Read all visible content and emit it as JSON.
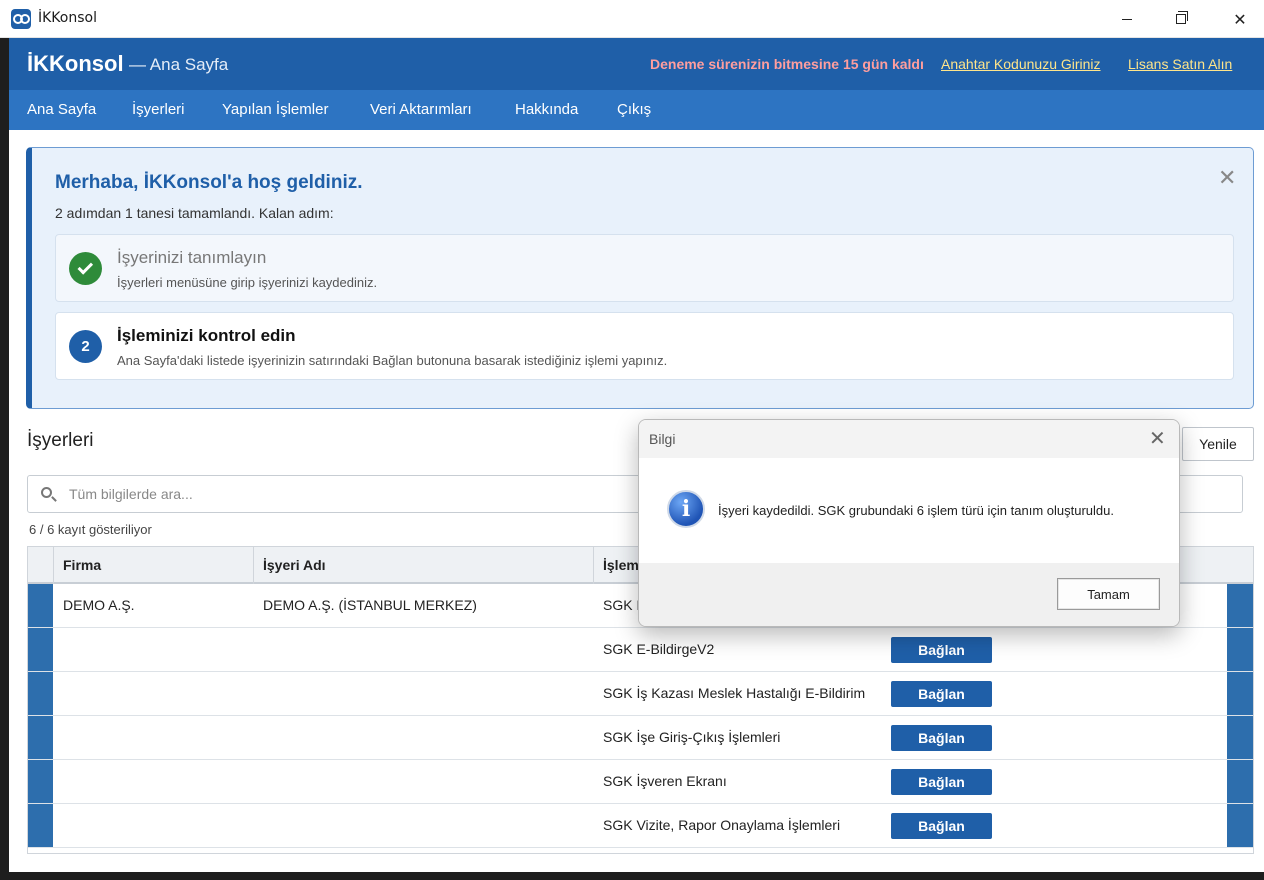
{
  "window": {
    "title": "İKKonsol"
  },
  "header": {
    "brand": "İKKonsol",
    "subtitle": "— Ana Sayfa",
    "trial_text": "Deneme sürenizin bitmesine 15 gün kaldı",
    "key_link": "Anahtar Kodunuzu Giriniz",
    "license_link": "Lisans Satın Alın",
    "colors": {
      "bar": "#1f5fa8",
      "nav": "#2d74c2",
      "trial": "#ff9e9e",
      "links": "#ffe58a"
    }
  },
  "nav": {
    "items": [
      "Ana Sayfa",
      "İşyerleri",
      "Yapılan İşlemler",
      "Veri Aktarımları",
      "Hakkında",
      "Çıkış"
    ]
  },
  "welcome": {
    "title": "Merhaba, İKKonsol'a hoş geldiniz.",
    "subtitle": "2 adımdan 1 tanesi tamamlandı. Kalan adım:",
    "steps": [
      {
        "title": "İşyerinizi tanımlayın",
        "desc": "İşyerleri menüsüne girip işyerinizi kaydediniz.",
        "status": "done"
      },
      {
        "number": "2",
        "title": "İşleminizi kontrol edin",
        "desc": "Ana Sayfa'daki listede işyerinizin satırındaki Bağlan butonuna basarak istediğiniz işlemi yapınız.",
        "status": "pending"
      }
    ]
  },
  "workplaces": {
    "title": "İşyerleri",
    "refresh_label": "Yenile",
    "search_placeholder": "Tüm bilgilerde ara...",
    "count_text": "6 / 6 kayıt gösteriliyor",
    "columns": [
      "Firma",
      "İşyeri Adı",
      "İşlem"
    ],
    "rows": [
      {
        "firma": "DEMO A.Ş.",
        "isyeri": "DEMO A.Ş. (İSTANBUL MERKEZ)",
        "islem": "SGK E",
        "button": ""
      },
      {
        "firma": "",
        "isyeri": "",
        "islem": "SGK E-BildirgeV2",
        "button": "Bağlan"
      },
      {
        "firma": "",
        "isyeri": "",
        "islem": "SGK İş Kazası Meslek Hastalığı E-Bildirim",
        "button": "Bağlan"
      },
      {
        "firma": "",
        "isyeri": "",
        "islem": "SGK İşe Giriş-Çıkış İşlemleri",
        "button": "Bağlan"
      },
      {
        "firma": "",
        "isyeri": "",
        "islem": "SGK İşveren Ekranı",
        "button": "Bağlan"
      },
      {
        "firma": "",
        "isyeri": "",
        "islem": "SGK Vizite, Rapor Onaylama İşlemleri",
        "button": "Bağlan"
      }
    ]
  },
  "dialog": {
    "title": "Bilgi",
    "message": "İşyeri kaydedildi. SGK grubundaki 6 işlem türü için tanım oluşturuldu.",
    "ok_label": "Tamam",
    "icon": "info-icon"
  }
}
